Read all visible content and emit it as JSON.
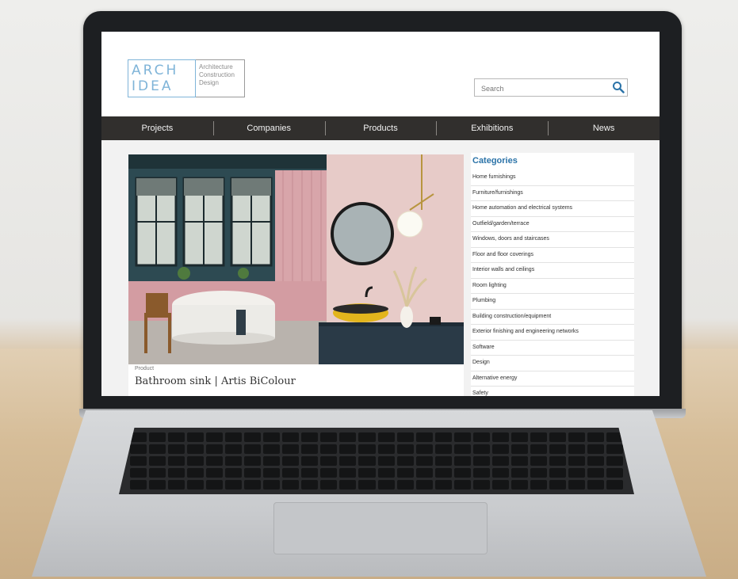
{
  "logo": {
    "mark_line1": "ARCH",
    "mark_line2": "IDEA",
    "tagline": [
      "Architecture",
      "Construction",
      "Design"
    ]
  },
  "search": {
    "placeholder": "Search",
    "icon": "search-icon"
  },
  "nav": {
    "items": [
      "Projects",
      "Companies",
      "Products",
      "Exhibitions",
      "News"
    ]
  },
  "featured": {
    "type": "Product",
    "title": "Bathroom sink | Artis BiColour"
  },
  "sidebar": {
    "title": "Categories",
    "items": [
      "Home furnishings",
      "Furniture/furnishings",
      "Home automation and electrical systems",
      "Outfield/garden/terrace",
      "Windows, doors and staircases",
      "Floor and floor coverings",
      "Interior walls and ceilings",
      "Room lighting",
      "Plumbing",
      "Building construction/equipment",
      "Exterior finishing and engineering networks",
      "Software",
      "Design",
      "Alternative energy",
      "Safety"
    ]
  },
  "colors": {
    "nav_bg": "#312f2d",
    "accent": "#2b73a8",
    "logo_blue": "#7fb4d8"
  }
}
